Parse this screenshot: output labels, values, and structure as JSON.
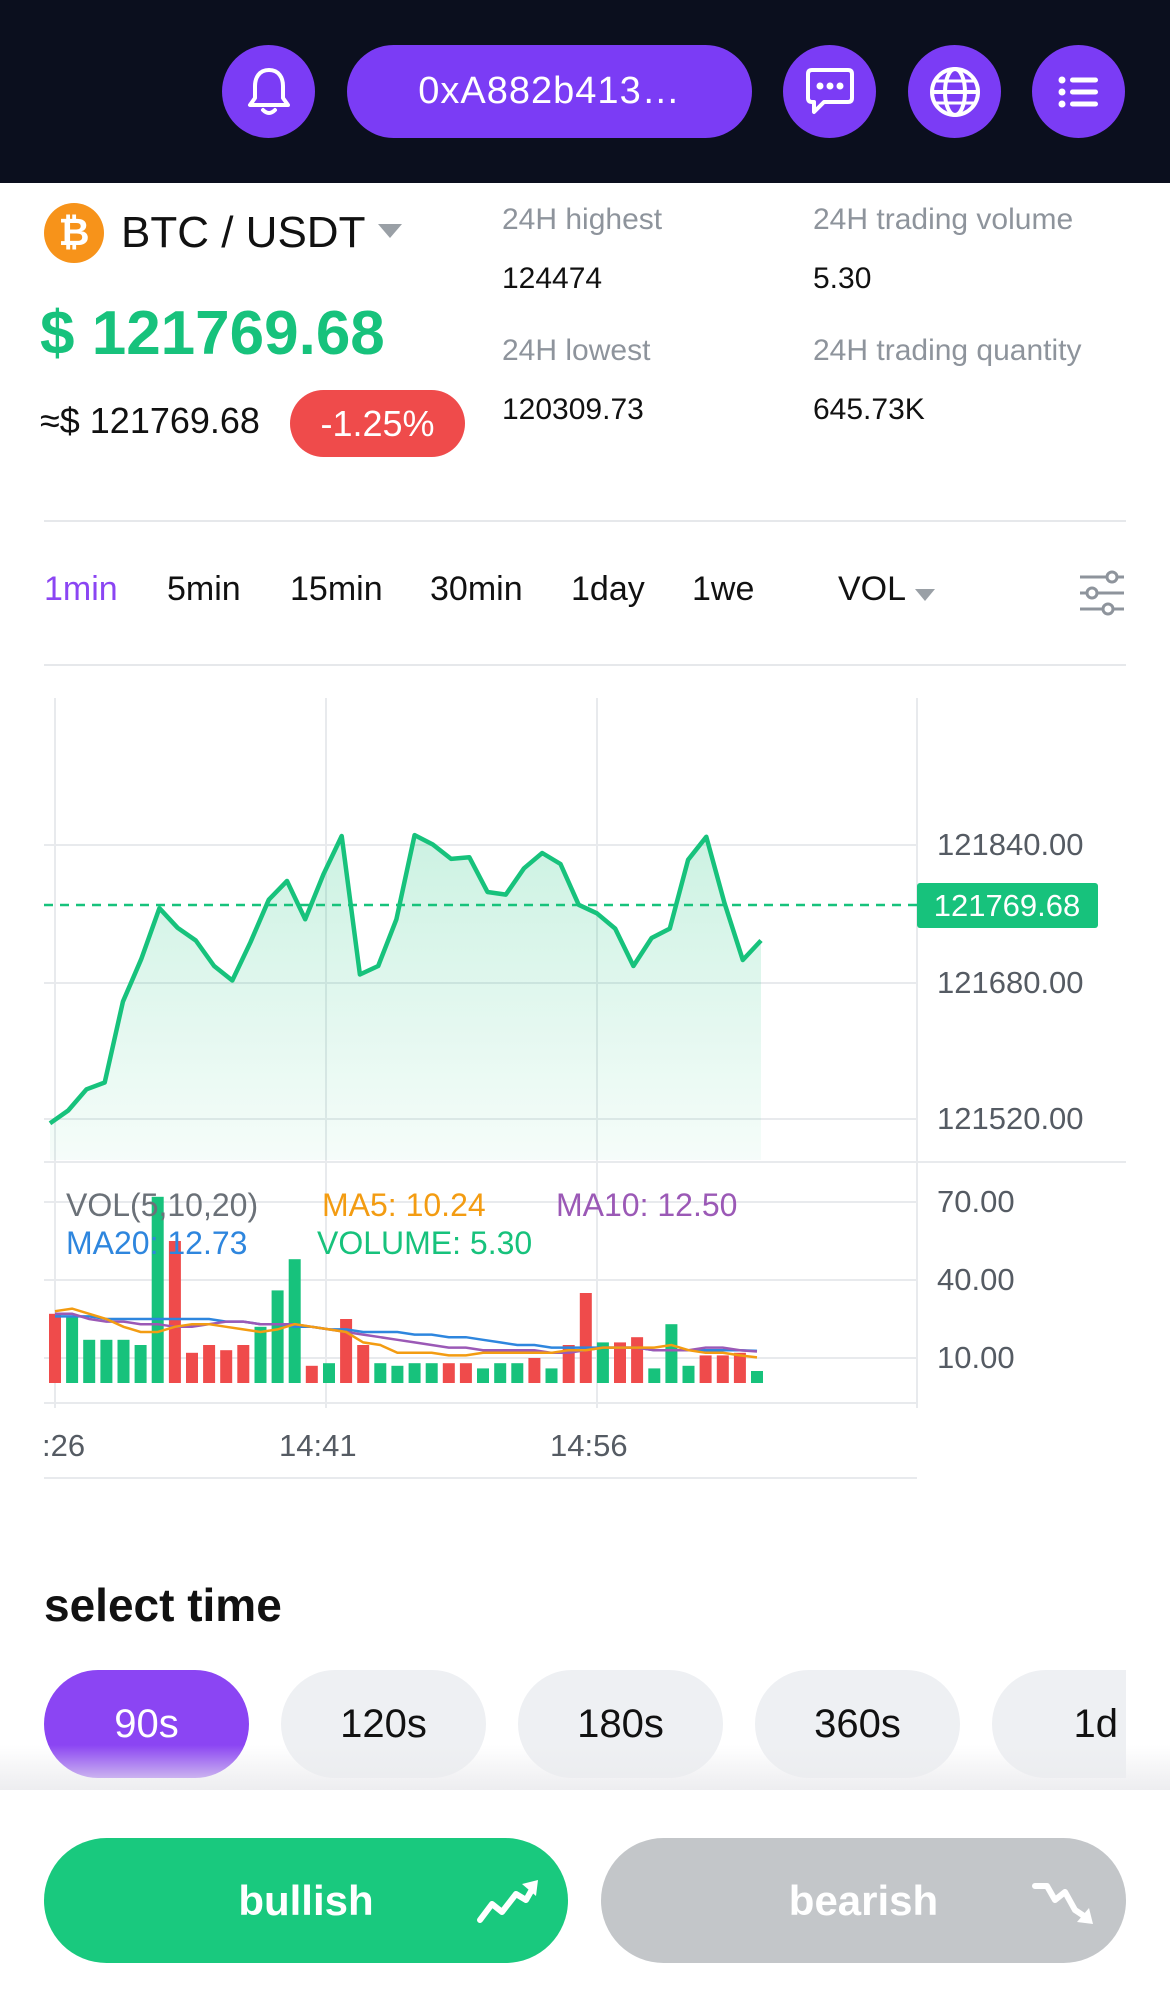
{
  "header": {
    "wallet_address": "0xA882b413…",
    "icons": [
      "bell-icon",
      "chat-icon",
      "globe-icon",
      "menu-list-icon"
    ]
  },
  "ticker": {
    "coin_symbol": "₿",
    "pair": "BTC / USDT",
    "price": "$ 121769.68",
    "approx_price": "≈$ 121769.68",
    "change": "-1.25%",
    "stats": {
      "high_label": "24H highest",
      "high_value": "124474",
      "low_label": "24H lowest",
      "low_value": "120309.73",
      "volume_label": "24H trading volume",
      "volume_value": "5.30",
      "quantity_label": "24H trading quantity",
      "quantity_value": "645.73K"
    }
  },
  "interval_tabs": [
    "1min",
    "5min",
    "15min",
    "30min",
    "1day",
    "1we"
  ],
  "active_interval": "1min",
  "indicator_select": "VOL",
  "chart_data": {
    "type": "area",
    "price_axis_labels": [
      "121840.00",
      "121680.00",
      "121520.00"
    ],
    "current_price_label": "121769.68",
    "time_labels": [
      ":26",
      "14:41",
      "14:56"
    ],
    "price_series": [
      121515,
      121530,
      121555,
      121563,
      121658,
      121708,
      121768,
      121745,
      121730,
      121700,
      121683,
      121728,
      121778,
      121800,
      121755,
      121808,
      121853,
      121690,
      121700,
      121755,
      121854,
      121843,
      121826,
      121828,
      121787,
      121784,
      121815,
      121833,
      121820,
      121772,
      121762,
      121744,
      121700,
      121733,
      121744,
      121825,
      121852,
      121774,
      121707,
      121730
    ],
    "volume_legend": {
      "title": "VOL(5,10,20)",
      "ma5": "MA5: 10.24",
      "ma10": "MA10: 12.50",
      "ma20": "MA20: 12.73",
      "volume": "VOLUME: 5.30"
    },
    "volume_axis_labels": [
      "70.00",
      "40.00",
      "10.00"
    ],
    "volumes": [
      27,
      26,
      17,
      17,
      17,
      15,
      72,
      55,
      12,
      15,
      13,
      15,
      22,
      36,
      48,
      7,
      8,
      25,
      15,
      8,
      7,
      8,
      8,
      8,
      8,
      6,
      8,
      8,
      10,
      6,
      15,
      35,
      16,
      16,
      18,
      6,
      23,
      7,
      11,
      11,
      12,
      5
    ],
    "volume_up": [
      0,
      1,
      1,
      1,
      1,
      1,
      1,
      0,
      0,
      0,
      0,
      0,
      1,
      1,
      1,
      0,
      1,
      0,
      0,
      1,
      1,
      1,
      1,
      0,
      0,
      1,
      1,
      1,
      0,
      1,
      0,
      0,
      1,
      0,
      0,
      1,
      1,
      1,
      0,
      0,
      0,
      1
    ],
    "ma5_series": [
      28,
      29,
      27,
      25,
      22,
      20,
      20,
      22,
      23,
      23,
      22,
      21,
      20,
      21,
      23,
      22,
      21,
      20,
      16,
      15,
      12,
      12,
      12,
      11,
      11,
      12,
      12,
      12,
      12,
      12,
      13,
      13,
      14,
      14,
      14,
      14,
      15,
      13,
      12,
      12,
      11,
      10.24
    ],
    "ma10_series": [
      27,
      27,
      25,
      24,
      24,
      23,
      23,
      22,
      22,
      23,
      24,
      24,
      23,
      23,
      23,
      22,
      21,
      20,
      19,
      18,
      17,
      16,
      15,
      14,
      14,
      13,
      13,
      13,
      13,
      12,
      12,
      13,
      14,
      14,
      14,
      13,
      13,
      13,
      14,
      14,
      13,
      12.5
    ],
    "ma20_series": [
      26,
      26,
      26,
      25,
      25,
      25,
      25,
      25,
      25,
      25,
      24,
      24,
      23,
      23,
      22,
      22,
      21,
      21,
      20,
      20,
      20,
      19,
      19,
      18,
      18,
      17,
      16,
      15,
      15,
      14,
      14,
      14,
      14,
      14,
      14,
      13,
      13,
      13,
      13,
      13,
      13,
      12.73
    ],
    "colors": {
      "up": "#17c27c",
      "down": "#ef4b4b",
      "ma5": "#f39c12",
      "ma10": "#9b59b6",
      "ma20": "#2e86de",
      "line": "#17c27c"
    }
  },
  "select_time": {
    "title": "select time",
    "options": [
      "90s",
      "120s",
      "180s",
      "360s",
      "1d"
    ],
    "selected": "90s"
  },
  "actions": {
    "bullish": "bullish",
    "bearish": "bearish"
  }
}
